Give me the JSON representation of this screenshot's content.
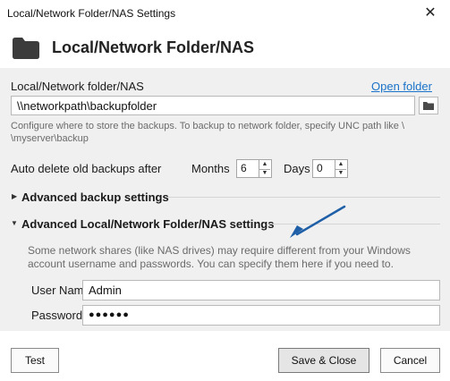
{
  "window": {
    "title": "Local/Network Folder/NAS Settings",
    "close_glyph": "✕"
  },
  "header": {
    "title": "Local/Network Folder/NAS",
    "icon": "folder-icon"
  },
  "folder": {
    "label": "Local/Network folder/NAS",
    "open_link": "Open folder",
    "path_value": "\\\\networkpath\\backupfolder",
    "hint_line1": "Configure where to store the backups. To backup to network folder, specify UNC path like \\",
    "hint_line2": "\\myserver\\backup"
  },
  "auto_delete": {
    "label": "Auto delete old backups after",
    "months_label": "Months",
    "months_value": "6",
    "days_label": "Days",
    "days_value": "0"
  },
  "sections": {
    "advanced_backup": "Advanced backup settings",
    "advanced_nas": "Advanced Local/Network Folder/NAS settings"
  },
  "credentials": {
    "hint_line1": "Some network shares (like NAS drives) may require different from your Windows",
    "hint_line2": "account username and passwords. You can specify them here if you need to.",
    "username_label": "User Name",
    "username_value": "Admin",
    "password_label": "Password",
    "password_value": "●●●●●●"
  },
  "footer": {
    "test": "Test",
    "save": "Save & Close",
    "cancel": "Cancel"
  },
  "colors": {
    "link": "#1a73c8",
    "arrow": "#1f5fa8",
    "panel": "#f0f0f0"
  }
}
